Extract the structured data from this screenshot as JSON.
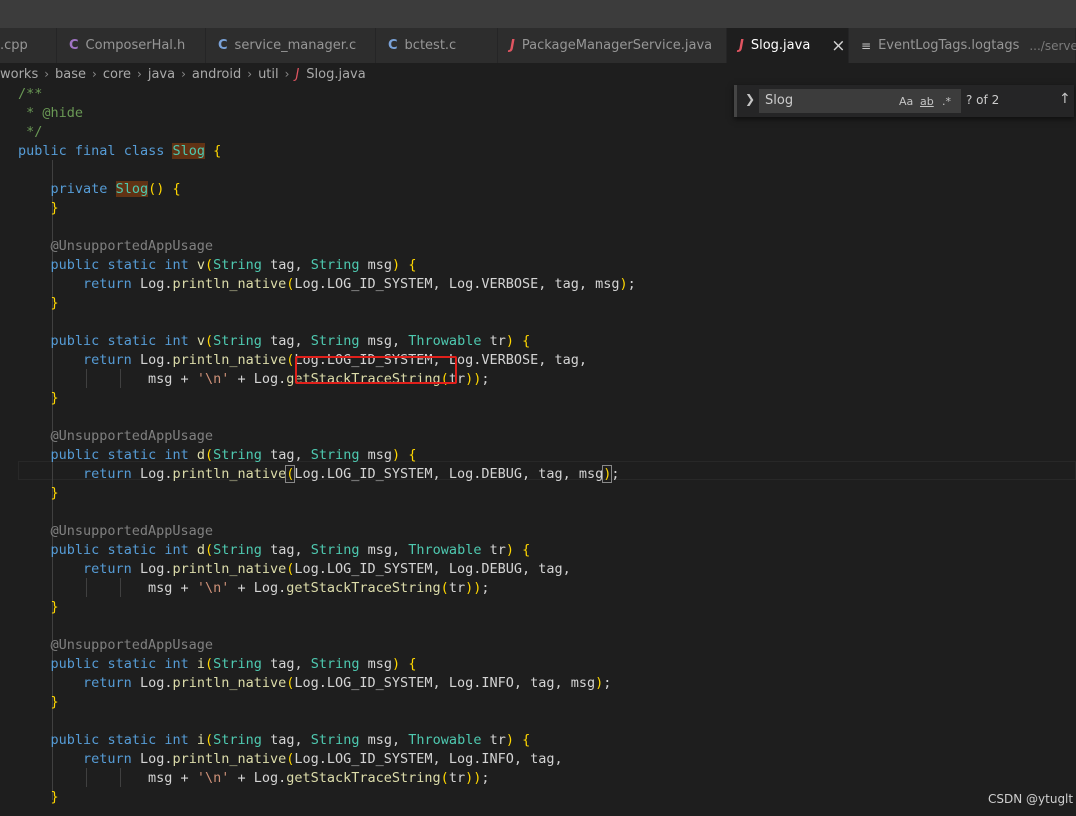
{
  "tabs": [
    {
      "icon": "",
      "label": ".cpp",
      "desc": "",
      "active": false
    },
    {
      "icon": "C",
      "label": "ComposerHal.h",
      "desc": "",
      "active": false
    },
    {
      "icon": "C",
      "label": "service_manager.c",
      "desc": "",
      "active": false
    },
    {
      "icon": "C",
      "label": "bctest.c",
      "desc": "",
      "active": false
    },
    {
      "icon": "J",
      "label": "PackageManagerService.java",
      "desc": "",
      "active": false
    },
    {
      "icon": "J",
      "label": "Slog.java",
      "desc": "",
      "active": true,
      "close": "×"
    },
    {
      "icon": "≡",
      "label": "EventLogTags.logtags",
      "desc": ".../server",
      "active": false
    }
  ],
  "breadcrumb": {
    "items": [
      "works",
      "base",
      "core",
      "java",
      "android",
      "util"
    ],
    "separator": "›",
    "file_icon": "J",
    "file": "Slog.java"
  },
  "find_widget": {
    "toggle_icon": "chevron-right-icon",
    "value": "Slog",
    "match_case": "Aa",
    "whole_word": "ab",
    "regex": ".*",
    "count": "? of 2",
    "prev_icon": "arrow-up-icon"
  },
  "code_lines": [
    "/**",
    " * @hide",
    " */",
    "public final class Slog {",
    "",
    "    private Slog() {",
    "    }",
    "",
    "    @UnsupportedAppUsage",
    "    public static int v(String tag, String msg) {",
    "        return Log.println_native(Log.LOG_ID_SYSTEM, Log.VERBOSE, tag, msg);",
    "    }",
    "",
    "    public static int v(String tag, String msg, Throwable tr) {",
    "        return Log.println_native(Log.LOG_ID_SYSTEM, Log.VERBOSE, tag,",
    "                msg + '\\n' + Log.getStackTraceString(tr));",
    "    }",
    "",
    "    @UnsupportedAppUsage",
    "    public static int d(String tag, String msg) {",
    "        return Log.println_native(Log.LOG_ID_SYSTEM, Log.DEBUG, tag, msg);",
    "    }",
    "",
    "    @UnsupportedAppUsage",
    "    public static int d(String tag, String msg, Throwable tr) {",
    "        return Log.println_native(Log.LOG_ID_SYSTEM, Log.DEBUG, tag,",
    "                msg + '\\n' + Log.getStackTraceString(tr));",
    "    }",
    "",
    "    @UnsupportedAppUsage",
    "    public static int i(String tag, String msg) {",
    "        return Log.println_native(Log.LOG_ID_SYSTEM, Log.INFO, tag, msg);",
    "    }",
    "",
    "    public static int i(String tag, String msg, Throwable tr) {",
    "        return Log.println_native(Log.LOG_ID_SYSTEM, Log.INFO, tag,",
    "                msg + '\\n' + Log.getStackTraceString(tr));",
    "    }"
  ],
  "watermark": "CSDN @ytuglt",
  "colors": {
    "keyword": "#569cd6",
    "comment": "#6a9955",
    "annotation": "#808080",
    "function": "#dcdcaa",
    "type": "#4ec9b0",
    "string": "#ce9178",
    "match_highlight": "#613214",
    "annotation_box": "#e0201b",
    "tab_active_bg": "#1e1e1e",
    "editor_bg": "#1e1e1e"
  }
}
